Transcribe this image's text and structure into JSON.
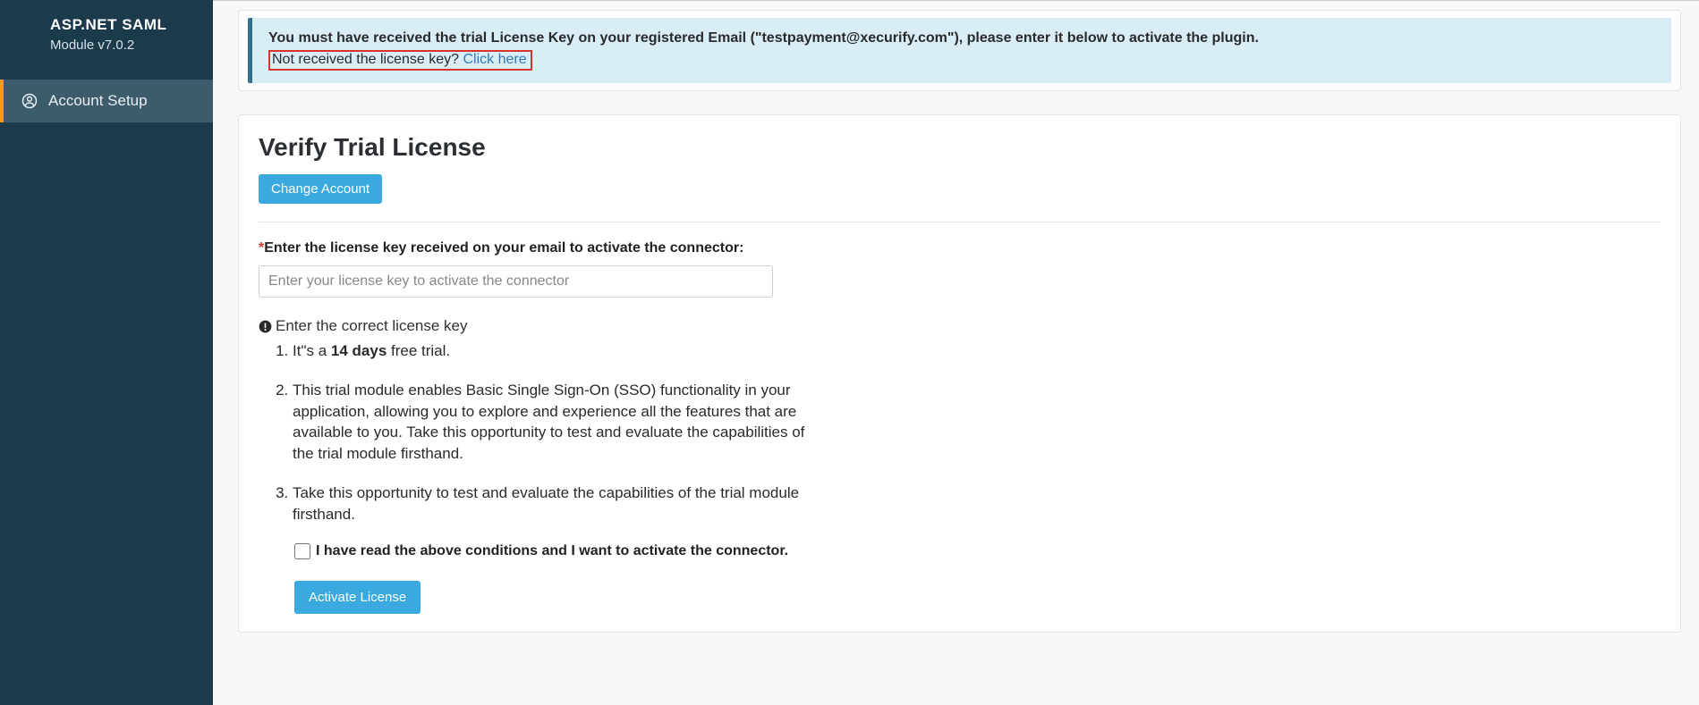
{
  "sidebar": {
    "brand_title": "ASP.NET SAML",
    "brand_subtitle": "Module v7.0.2",
    "nav": {
      "account_setup": "Account Setup"
    }
  },
  "notice": {
    "line1": "You must have received the trial License Key on your registered Email (\"testpayment@xecurify.com\"), please enter it below to activate the plugin.",
    "not_received_text": "Not received the license key? ",
    "click_here": "Click here"
  },
  "license": {
    "title": "Verify Trial License",
    "change_account": "Change Account",
    "field_label": "Enter the license key received on your email to activate the connector:",
    "input_placeholder": "Enter your license key to activate the connector",
    "input_value": "",
    "warn_text": "Enter the correct license key",
    "conditions": {
      "c1_prefix": "It\"s a ",
      "c1_bold": "14 days",
      "c1_suffix": " free trial.",
      "c2": "This trial module enables Basic Single Sign-On (SSO) functionality in your application, allowing you to explore and experience all the features that are available to you. Take this opportunity to test and evaluate the capabilities of the trial module firsthand.",
      "c3": "Take this opportunity to test and evaluate the capabilities of the trial module firsthand."
    },
    "consent_label": "I have read the above conditions and I want to activate the connector.",
    "activate_button": "Activate License"
  }
}
